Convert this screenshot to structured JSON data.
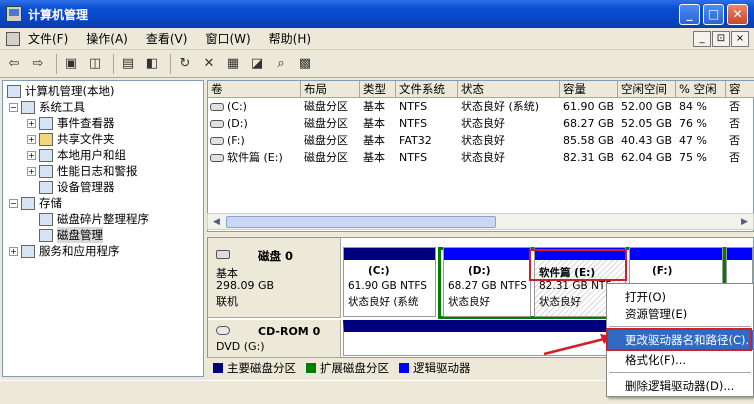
{
  "window": {
    "title": "计算机管理",
    "min": "_",
    "max": "□",
    "close": "✕"
  },
  "menu": [
    "文件(F)",
    "操作(A)",
    "查看(V)",
    "窗口(W)",
    "帮助(H)"
  ],
  "mdi": {
    "min": "_",
    "restore": "⊡",
    "close": "×"
  },
  "tree": {
    "root": "计算机管理(本地)",
    "system_tools": "系统工具",
    "event_viewer": "事件查看器",
    "shared_folders": "共享文件夹",
    "local_users": "本地用户和组",
    "perf_logs": "性能日志和警报",
    "device_manager": "设备管理器",
    "storage": "存储",
    "defrag": "磁盘碎片整理程序",
    "disk_mgmt": "磁盘管理",
    "services": "服务和应用程序"
  },
  "columns": [
    "卷",
    "布局",
    "类型",
    "文件系统",
    "状态",
    "容量",
    "空闲空间",
    "% 空闲",
    "容"
  ],
  "volumes": [
    {
      "name": "(C:)",
      "layout": "磁盘分区",
      "type": "基本",
      "fs": "NTFS",
      "status": "状态良好 (系统)",
      "capacity": "61.90 GB",
      "free": "52.00 GB",
      "pct": "84 %",
      "fault": "否"
    },
    {
      "name": "(D:)",
      "layout": "磁盘分区",
      "type": "基本",
      "fs": "NTFS",
      "status": "状态良好",
      "capacity": "68.27 GB",
      "free": "52.05 GB",
      "pct": "76 %",
      "fault": "否"
    },
    {
      "name": "(F:)",
      "layout": "磁盘分区",
      "type": "基本",
      "fs": "FAT32",
      "status": "状态良好",
      "capacity": "85.58 GB",
      "free": "40.43 GB",
      "pct": "47 %",
      "fault": "否"
    },
    {
      "name": "软件篇 (E:)",
      "layout": "磁盘分区",
      "type": "基本",
      "fs": "NTFS",
      "status": "状态良好",
      "capacity": "82.31 GB",
      "free": "62.04 GB",
      "pct": "75 %",
      "fault": "否"
    }
  ],
  "disk0": {
    "name": "磁盘 0",
    "type": "基本",
    "size": "298.09 GB",
    "state": "联机"
  },
  "partitions": {
    "c": {
      "label": "(C:)",
      "size": "61.90 GB NTFS",
      "status": "状态良好 (系统"
    },
    "d": {
      "label": "(D:)",
      "size": "68.27 GB NTFS",
      "status": "状态良好"
    },
    "e": {
      "label": "软件篇   (E:)",
      "size": "82.31 GB NTF",
      "status": "状态良好"
    },
    "f": {
      "label": "(F:)",
      "size": "",
      "status": ""
    }
  },
  "cdrom": {
    "name": "CD-ROM 0",
    "type": "DVD (G:)"
  },
  "legend": [
    "主要磁盘分区",
    "扩展磁盘分区",
    "逻辑驱动器"
  ],
  "context_menu": {
    "open": "打开(O)",
    "explore": "资源管理(E)",
    "change_letter": "更改驱动器名和路径(C)...",
    "format": "格式化(F)...",
    "delete": "删除逻辑驱动器(D)..."
  },
  "colors": {
    "primary": "#00007e",
    "extended": "#007e00",
    "logical": "#0000ff",
    "highlight": "#d21e2a"
  }
}
